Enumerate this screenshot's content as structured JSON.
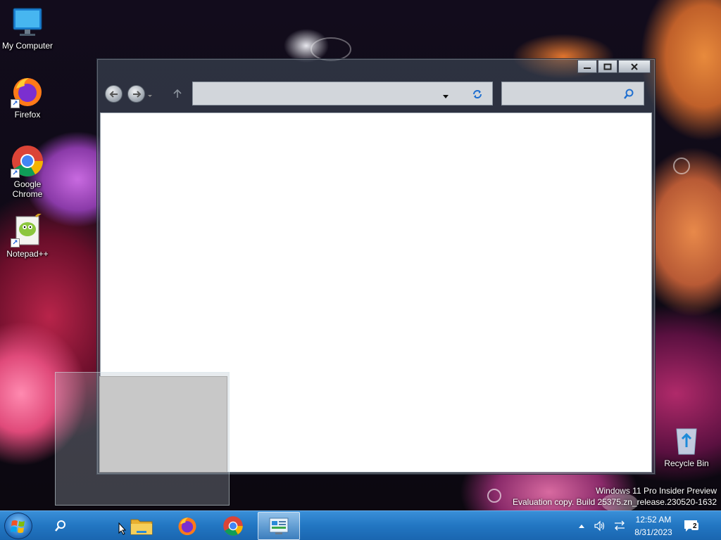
{
  "desktop": {
    "icons": [
      {
        "label": "My Computer"
      },
      {
        "label": "Firefox"
      },
      {
        "label": "Google Chrome"
      },
      {
        "label": "Notepad++"
      },
      {
        "label": "Recycle Bin"
      }
    ],
    "watermark": {
      "line1": "Windows 11 Pro Insider Preview",
      "line2": "Evaluation copy. Build 25375.zn_release.230520-1632"
    }
  },
  "window": {
    "address_value": "",
    "search_value": ""
  },
  "taskbar": {
    "pinned": [
      "search-icon",
      "file-explorer-icon",
      "firefox-icon",
      "chrome-icon",
      "control-panel-icon"
    ],
    "tray": {
      "time": "12:52 AM",
      "date": "8/31/2023",
      "notification_count": "2"
    }
  },
  "colors": {
    "taskbar": "#2276c2",
    "window_frame": "#465260",
    "content_bg": "#ffffff"
  }
}
